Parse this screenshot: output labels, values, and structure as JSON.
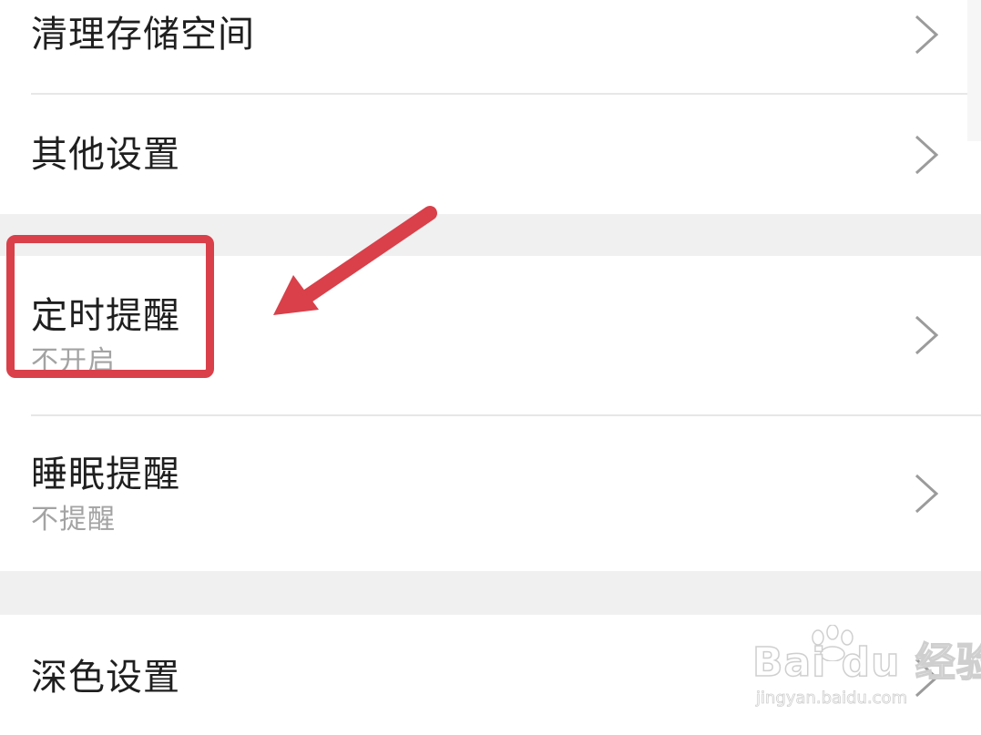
{
  "settings": {
    "items": [
      {
        "title": "清理存储空间",
        "subtitle": ""
      },
      {
        "title": "其他设置",
        "subtitle": ""
      },
      {
        "title": "定时提醒",
        "subtitle": "不开启"
      },
      {
        "title": "睡眠提醒",
        "subtitle": "不提醒"
      },
      {
        "title": "深色设置",
        "subtitle": ""
      }
    ]
  },
  "icons": {
    "chevron": "chevron-right-icon"
  },
  "annotation": {
    "highlight_color": "#d9404a"
  },
  "watermark": {
    "logo_text": "Bai du 经验",
    "url": "jingyan.baidu.com"
  },
  "colors": {
    "title_text": "#1f1f1f",
    "subtitle_text": "#a3a3a3",
    "divider": "#e7e7e7",
    "section_gap": "#f0f0f0",
    "chevron": "#9b9b9b"
  }
}
